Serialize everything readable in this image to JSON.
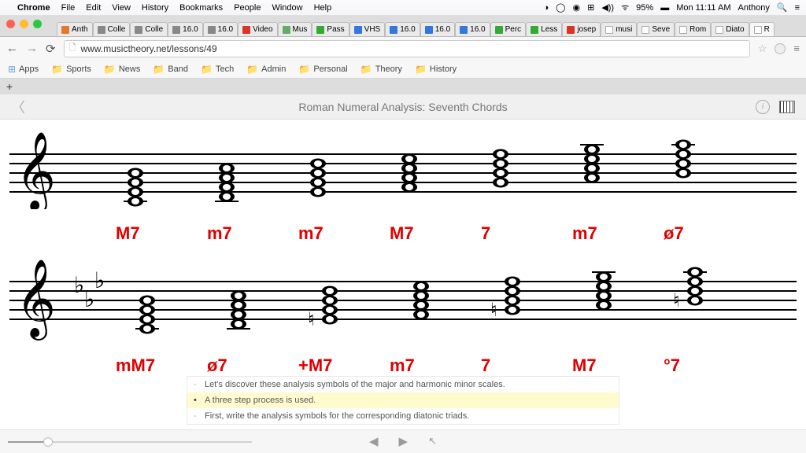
{
  "mac_menu": {
    "app": "Chrome",
    "items": [
      "File",
      "Edit",
      "View",
      "History",
      "Bookmarks",
      "People",
      "Window",
      "Help"
    ],
    "battery": "95%",
    "clock": "Mon 11:11 AM",
    "user": "Anthony"
  },
  "tabs": [
    {
      "label": "Anth",
      "fav": "o"
    },
    {
      "label": "Colle",
      "fav": ""
    },
    {
      "label": "Colle",
      "fav": ""
    },
    {
      "label": "16.0",
      "fav": ""
    },
    {
      "label": "16.0",
      "fav": ""
    },
    {
      "label": "Video",
      "fav": "yt"
    },
    {
      "label": "Mus",
      "fav": "m"
    },
    {
      "label": "Pass",
      "fav": "g"
    },
    {
      "label": "VHS",
      "fav": "b"
    },
    {
      "label": "16.0",
      "fav": "b"
    },
    {
      "label": "16.0",
      "fav": "b"
    },
    {
      "label": "16.0",
      "fav": "b"
    },
    {
      "label": "Perc",
      "fav": "g"
    },
    {
      "label": "Less",
      "fav": "g"
    },
    {
      "label": "josep",
      "fav": "yt"
    },
    {
      "label": "musi",
      "fav": "w"
    },
    {
      "label": "Seve",
      "fav": "w"
    },
    {
      "label": "Rom",
      "fav": "w"
    },
    {
      "label": "Diato",
      "fav": "w"
    },
    {
      "label": "R",
      "fav": "w",
      "active": true
    }
  ],
  "url": "www.musictheory.net/lessons/49",
  "bookmarks": [
    "Sports",
    "News",
    "Band",
    "Tech",
    "Admin",
    "Personal",
    "Theory",
    "History"
  ],
  "apps_label": "Apps",
  "page": {
    "title": "Roman Numeral Analysis: Seventh Chords"
  },
  "labels_top": [
    "M7",
    "m7",
    "m7",
    "M7",
    "7",
    "m7",
    "ø7"
  ],
  "labels_bot": [
    "mM7",
    "ø7",
    "+M7",
    "m7",
    "7",
    "M7",
    "°7"
  ],
  "transcript": {
    "lines": [
      "Let's discover these analysis symbols of the major and harmonic minor scales.",
      "A three step process is used.",
      "First, write the analysis symbols for the corresponding diatonic triads."
    ],
    "highlight_index": 1
  }
}
